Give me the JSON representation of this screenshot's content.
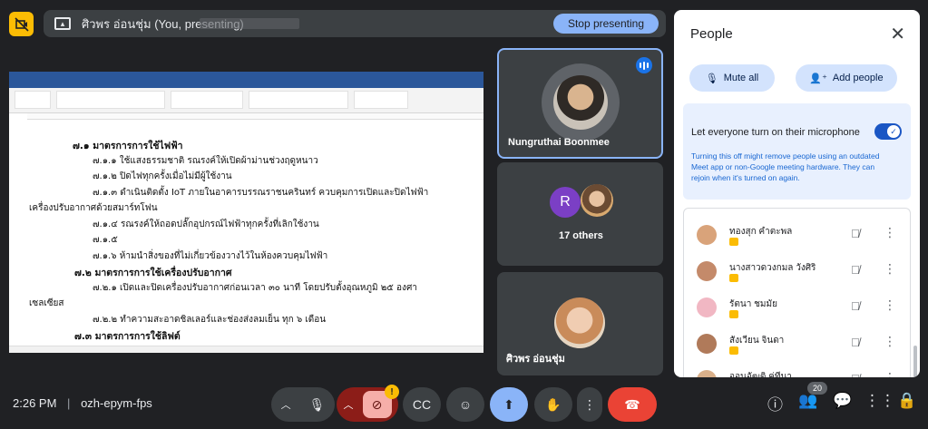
{
  "presenting": {
    "name": "ศิวพร อ่อนชุ่ม (You, presenting)",
    "stop_label": "Stop presenting"
  },
  "document": {
    "lines": [
      {
        "text": "๗.๑ มาตรการการใช้ไฟฟ้า",
        "bold": true
      },
      {
        "text": "๗.๑.๑ ใช้แสงธรรมชาติ รณรงค์ให้เปิดผ้าม่านช่วงฤดูหนาว",
        "bold": false
      },
      {
        "text": "๗.๑.๒ ปิดไฟทุกครั้งเมื่อไม่มีผู้ใช้งาน",
        "bold": false
      },
      {
        "text": "๗.๑.๓ ดำเนินติดตั้ง IoT ภายในอาคารบรรณราชนครินทร์ ควบคุมการเปิดและปิดไฟฟ้า",
        "bold": false
      },
      {
        "text": "เครื่องปรับอากาศด้วยสมาร์ทโฟน",
        "bold": false
      },
      {
        "text": "๗.๑.๔ รณรงค์ให้ถอดปลั๊กอุปกรณ์ไฟฟ้าทุกครั้งที่เลิกใช้งาน",
        "bold": false
      },
      {
        "text": "๗.๑.๕",
        "bold": false
      },
      {
        "text": "๗.๑.๖ ห้ามนำสิ่งของที่ไม่เกี่ยวข้องวางไว้ในห้องควบคุมไฟฟ้า",
        "bold": false
      },
      {
        "text": "๗.๒ มาตรการการใช้เครื่องปรับอากาศ",
        "bold": true
      },
      {
        "text": "๗.๒.๑ เปิดและปิดเครื่องปรับอากาศก่อนเวลา ๓๐ นาที โดยปรับตั้งอุณหภูมิ ๒๕ องศา",
        "bold": false
      },
      {
        "text": "เซลเซียส",
        "bold": false
      },
      {
        "text": "๗.๒.๒ ทำความสะอาดชิลเลอร์และช่องส่งลมเย็น ทุก ๖ เดือน",
        "bold": false
      },
      {
        "text": "๗.๓ มาตรการการใช้ลิฟต์",
        "bold": true
      }
    ]
  },
  "tiles": [
    {
      "name": "Nungruthai Boonmee"
    },
    {
      "name": "17 others",
      "initial": "R"
    },
    {
      "name": "ศิวพร อ่อนชุ่ม"
    }
  ],
  "people": {
    "title": "People",
    "mute_all": "Mute all",
    "add_people": "Add people",
    "mic_toggle_label": "Let everyone turn on their microphone",
    "mic_note": "Turning this off might remove people using an outdated Meet app or non-Google meeting hardware. They can rejoin when it's turned on again.",
    "participants": [
      {
        "name": "ทองสุก คำตะพล"
      },
      {
        "name": "นางสาวดวงกมล วังศิริ"
      },
      {
        "name": "รัตนา ชมมัย"
      },
      {
        "name": "สังเวียน จินดา"
      },
      {
        "name": "ออนอัฒติ ค่ทีนา"
      }
    ]
  },
  "bottom": {
    "time": "2:26 PM",
    "meeting_code": "ozh-epym-fps",
    "separator": "|",
    "people_count": "20",
    "warning": "!"
  },
  "colors": {
    "accent": "#8ab4f8",
    "end_call": "#ea4335",
    "warning": "#fbbc04"
  }
}
